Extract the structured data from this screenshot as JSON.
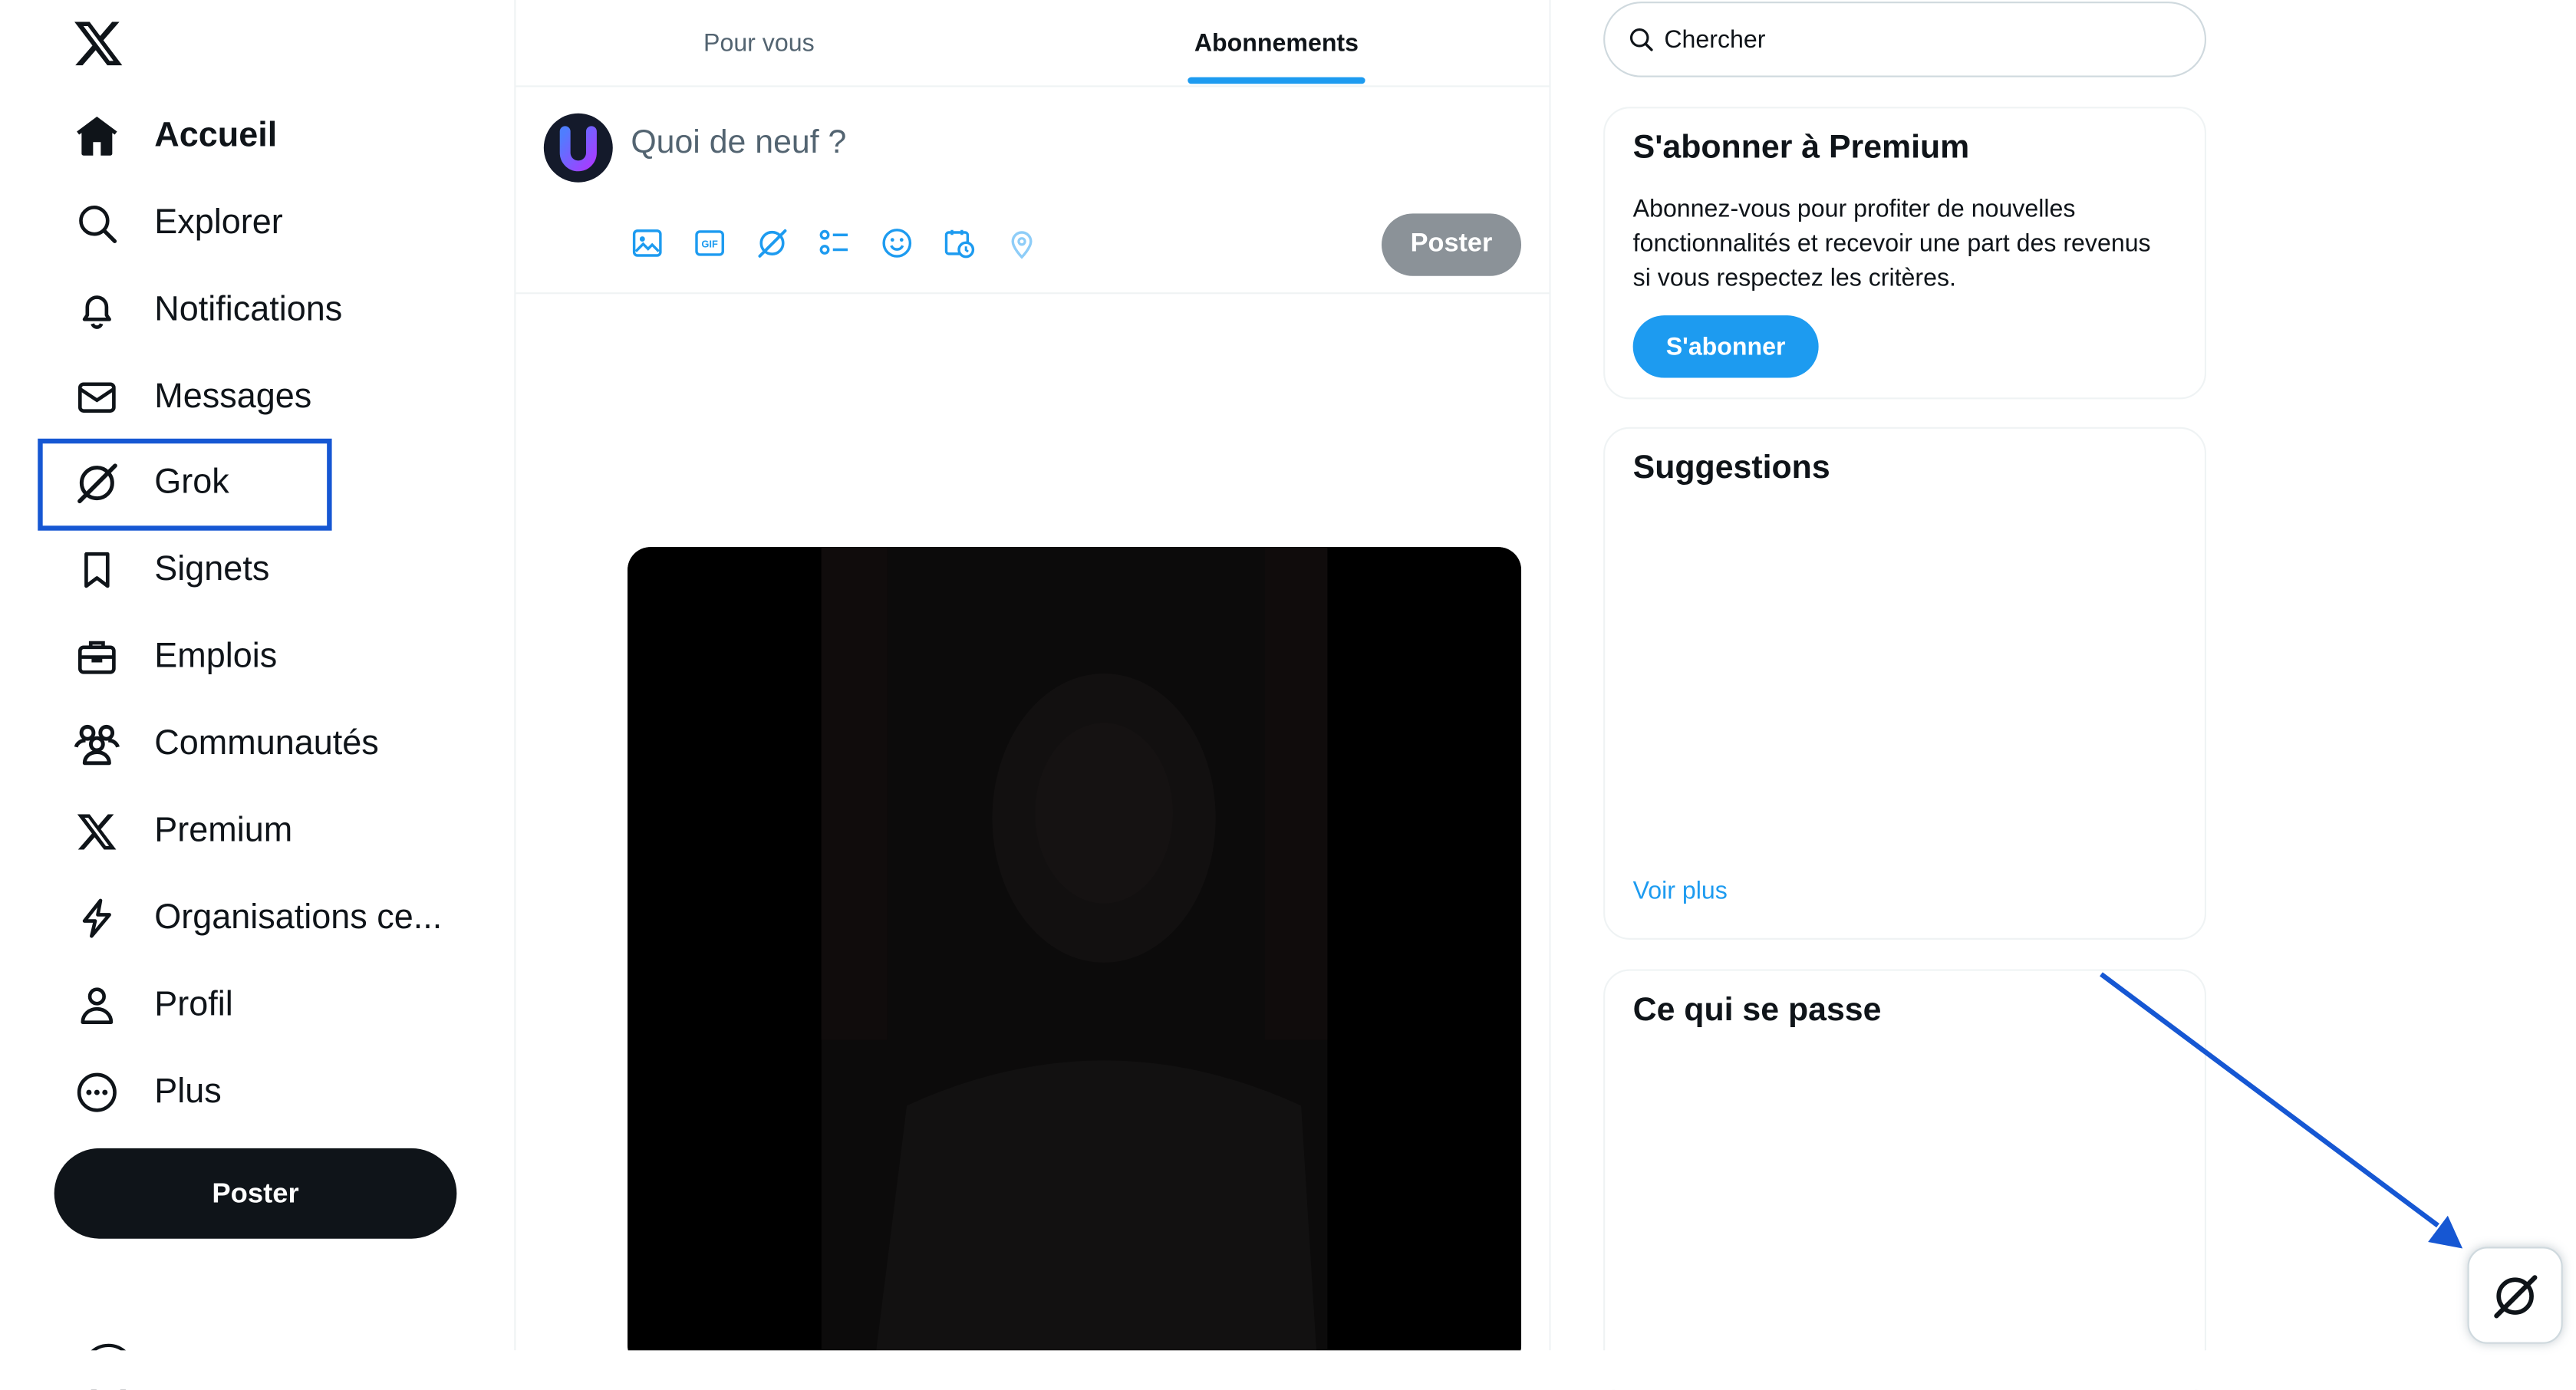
{
  "nav": {
    "items": [
      {
        "label": "Accueil",
        "icon": "home-icon",
        "active": true
      },
      {
        "label": "Explorer",
        "icon": "search-icon"
      },
      {
        "label": "Notifications",
        "icon": "bell-icon"
      },
      {
        "label": "Messages",
        "icon": "envelope-icon"
      },
      {
        "label": "Grok",
        "icon": "grok-icon",
        "highlighted": true
      },
      {
        "label": "Signets",
        "icon": "bookmark-icon"
      },
      {
        "label": "Emplois",
        "icon": "briefcase-icon"
      },
      {
        "label": "Communautés",
        "icon": "people-icon"
      },
      {
        "label": "Premium",
        "icon": "x-logo-icon"
      },
      {
        "label": "Organisations ce...",
        "icon": "lightning-icon"
      },
      {
        "label": "Profil",
        "icon": "person-icon"
      },
      {
        "label": "Plus",
        "icon": "more-circle-icon"
      }
    ],
    "post_button": "Poster"
  },
  "tabs": [
    {
      "label": "Pour vous",
      "active": false
    },
    {
      "label": "Abonnements",
      "active": true
    }
  ],
  "composer": {
    "placeholder": "Quoi de neuf ?",
    "post_button": "Poster",
    "tools": [
      "image-icon",
      "gif-icon",
      "grok-icon",
      "poll-icon",
      "emoji-icon",
      "schedule-icon",
      "location-icon"
    ]
  },
  "search": {
    "placeholder": "Chercher"
  },
  "premium_card": {
    "title": "S'abonner à Premium",
    "text": "Abonnez-vous pour profiter de nouvelles fonctionnalités et recevoir une part des revenus si vous respectez les critères.",
    "button": "S'abonner"
  },
  "suggestions_card": {
    "title": "Suggestions",
    "see_more": "Voir plus"
  },
  "trending_card": {
    "title": "Ce qui se passe"
  },
  "colors": {
    "accent": "#1d9bf0",
    "highlight_box": "#1657d3",
    "arrow": "#1657d3",
    "text": "#0f1419",
    "muted": "#536471"
  }
}
